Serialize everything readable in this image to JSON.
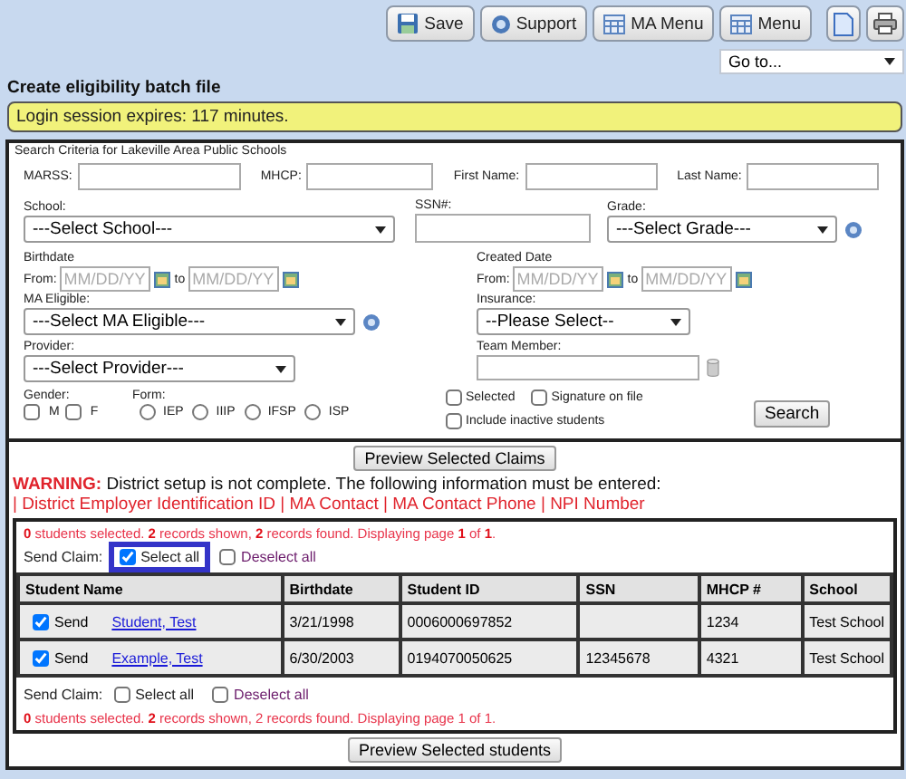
{
  "toolbar": {
    "buttons": [
      {
        "kind": "save",
        "label": "Save"
      },
      {
        "kind": "support",
        "label": "Support"
      },
      {
        "kind": "grid",
        "label": "MA Menu"
      },
      {
        "kind": "grid",
        "label": "Menu"
      },
      {
        "kind": "page"
      },
      {
        "kind": "print"
      }
    ],
    "goto": "Go to..."
  },
  "page_title": "Create eligibility batch file",
  "session_notice": "Login session expires: 117 minutes.",
  "search": {
    "title": "Search Criteria for Lakeville Area Public Schools",
    "text_fields": [
      {
        "label": "MARSS:"
      },
      {
        "label": "MHCP:"
      },
      {
        "label": "First Name:"
      },
      {
        "label": "Last Name:"
      }
    ],
    "school": {
      "label": "School:",
      "value": "---Select School---"
    },
    "ssn": {
      "label": "SSN#:"
    },
    "grade": {
      "label": "Grade:",
      "value": "---Select Grade---"
    },
    "birthdate": {
      "label": "Birthdate",
      "from": "From:",
      "to": "to",
      "from_placeholder": "MM/DD/YY",
      "to_placeholder": "MM/DD/YY"
    },
    "created_date": {
      "label": "Created Date",
      "from": "From:",
      "to": "to",
      "from_placeholder": "MM/DD/YY",
      "to_placeholder": "MM/DD/YY"
    },
    "ma_eligible": {
      "label": "MA Eligible:",
      "value": "---Select MA Eligible---"
    },
    "insurance": {
      "label": "Insurance:",
      "value": "--Please Select--"
    },
    "provider": {
      "label": "Provider:",
      "value": "---Select Provider---"
    },
    "team_member": {
      "label": "Team Member:"
    },
    "gender": {
      "label": "Gender:",
      "options": [
        {
          "label": "M",
          "checked": false
        },
        {
          "label": "F",
          "checked": false
        }
      ]
    },
    "form": {
      "label": "Form:",
      "options": [
        {
          "label": "IEP",
          "selected": false
        },
        {
          "label": "IIIP",
          "selected": false
        },
        {
          "label": "IFSP",
          "selected": false
        },
        {
          "label": "ISP",
          "selected": false
        }
      ]
    },
    "flags": [
      {
        "label": "Selected",
        "checked": false
      },
      {
        "label": "Signature on file",
        "checked": false
      },
      {
        "label": "Include inactive students",
        "checked": false
      }
    ],
    "search_button": "Search"
  },
  "preview_claims_button": "Preview Selected Claims",
  "warning": {
    "label": "WARNING:",
    "message": "District setup is not complete. The following information must be entered:",
    "items": "| District Employer Identification ID | MA Contact | MA Contact Phone | NPI Number"
  },
  "results": {
    "status_top": "**0** students selected. **2** records shown, **2** records found. Displaying page **1** of **1**.",
    "send_claim_top": {
      "label": "Send Claim:",
      "highlighted": true,
      "select_all": {
        "label": "Select all",
        "checked": true
      },
      "deselect_all": {
        "label": "Deselect all",
        "checked": false
      }
    },
    "columns": [
      "Student Name",
      "Birthdate",
      "Student ID",
      "SSN",
      "MHCP #",
      "School"
    ],
    "rows": [
      {
        "checked": true,
        "send": "Send",
        "name": "Student, Test",
        "birthdate": "3/21/1998",
        "student_id": "0006000697852",
        "mhcp": "1234",
        "school": "Test School"
      },
      {
        "checked": true,
        "send": "Send",
        "name": "Example, Test",
        "birthdate": "6/30/2003",
        "student_id": "0194070050625",
        "ssn": "12345678",
        "mhcp": "4321",
        "school": "Test School"
      }
    ],
    "send_claim_bottom": {
      "label": "Send Claim:",
      "highlighted": false,
      "select_all": {
        "label": "Select all",
        "checked": false
      },
      "deselect_all": {
        "label": "Deselect all",
        "checked": false
      }
    },
    "status_bottom": "**0** students selected. **2** records shown, 2 records found. Displaying page 1 of 1."
  },
  "preview_students_button": "Preview Selected students"
}
